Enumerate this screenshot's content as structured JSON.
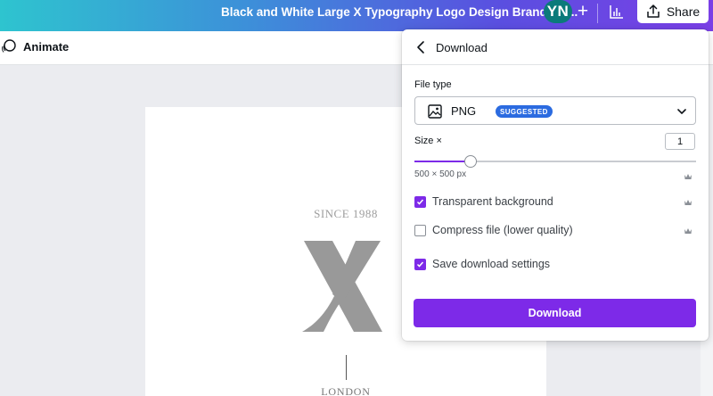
{
  "topbar": {
    "doc_title": "Black and White Large X Typography Logo Design Brand Ide...",
    "avatar_initials": "YN",
    "plus_label": "+",
    "share_label": "Share"
  },
  "toolbar": {
    "animate_label": "Animate"
  },
  "canvas": {
    "since_text": "SINCE 1988",
    "city_text": "LONDON",
    "logo_color": "#999999"
  },
  "download_panel": {
    "title": "Download",
    "file_type_label": "File type",
    "file_type_value": "PNG",
    "file_type_badge": "SUGGESTED",
    "size_label": "Size ×",
    "size_value": "1",
    "size_slider_fraction": 0.2,
    "dimensions_text": "500 × 500 px",
    "options": [
      {
        "label": "Transparent background",
        "checked": true,
        "premium": true
      },
      {
        "label": "Compress file (lower quality)",
        "checked": false,
        "premium": true
      },
      {
        "label": "Save download settings",
        "checked": true,
        "premium": false
      }
    ],
    "download_button_label": "Download"
  },
  "colors": {
    "accent": "#7d2ae8",
    "badge": "#2b6be0",
    "avatar_bg": "#0b7a7a"
  },
  "icons": [
    "animate-icon",
    "insights-icon",
    "share-icon",
    "back-chevron-icon",
    "image-icon",
    "chevron-down-icon",
    "crown-icon",
    "checkmark-icon"
  ]
}
